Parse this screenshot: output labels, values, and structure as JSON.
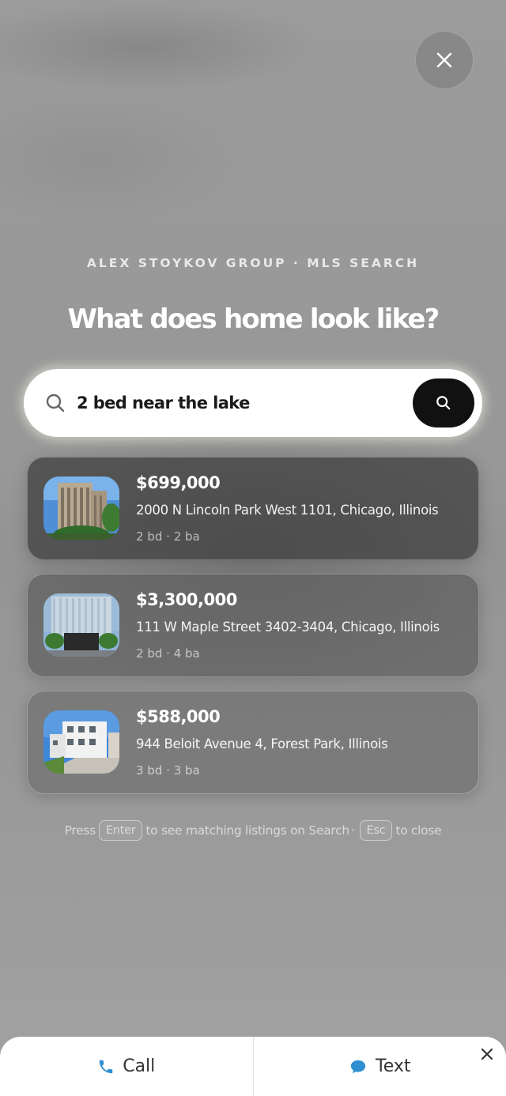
{
  "overlay": {
    "close_icon": "close-icon"
  },
  "header": {
    "eyebrow": "ALEX STOYKOV GROUP · MLS SEARCH",
    "headline": "What does home look like?"
  },
  "search": {
    "value": "2 bed near the lake",
    "leading_icon": "search-icon",
    "submit_icon": "search-icon"
  },
  "listings": [
    {
      "price": "$699,000",
      "address": "2000 N Lincoln Park West 1101, Chicago, Illinois",
      "beds": "2 bd",
      "baths": "2 ba",
      "sep": "·"
    },
    {
      "price": "$3,300,000",
      "address": "111 W Maple Street 3402-3404, Chicago, Illinois",
      "beds": "2 bd",
      "baths": "4 ba",
      "sep": "·"
    },
    {
      "price": "$588,000",
      "address": "944 Beloit Avenue 4, Forest Park, Illinois",
      "beds": "3 bd",
      "baths": "3 ba",
      "sep": "·"
    }
  ],
  "hint": {
    "press": "Press",
    "enter_key": "Enter",
    "enter_text": "to see matching listings on Search",
    "sep": "·",
    "esc_key": "Esc",
    "esc_text": "to close"
  },
  "bottom_bar": {
    "call_label": "Call",
    "text_label": "Text",
    "call_icon": "phone-icon",
    "text_icon": "chat-bubble-icon",
    "close_icon": "close-icon",
    "accent": "#2f8fd0"
  }
}
